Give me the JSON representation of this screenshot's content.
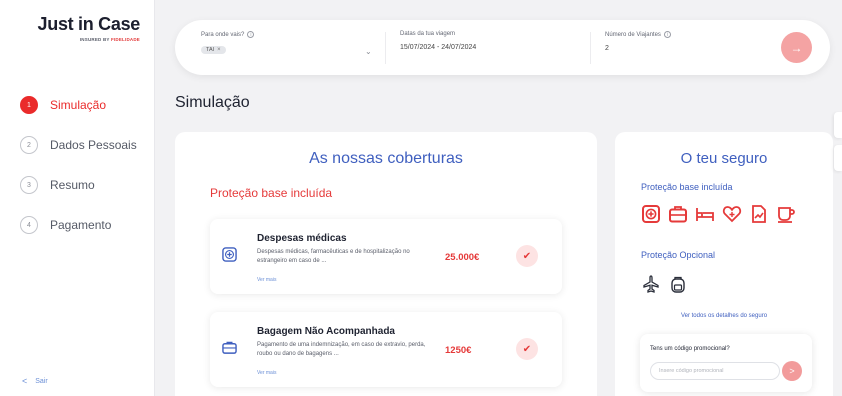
{
  "brand": {
    "name": "Just in Case",
    "sub_prefix": "INSURED BY",
    "sub_brand": "FIDELIDADE"
  },
  "steps": [
    {
      "num": "1",
      "label": "Simulação",
      "active": true
    },
    {
      "num": "2",
      "label": "Dados Pessoais",
      "active": false
    },
    {
      "num": "3",
      "label": "Resumo",
      "active": false
    },
    {
      "num": "4",
      "label": "Pagamento",
      "active": false
    }
  ],
  "logout": {
    "label": "Sair"
  },
  "search": {
    "destination_label": "Para onde vais?",
    "destination_tag": "TAI",
    "dates_label": "Datas da tua viagem",
    "dates_value": "15/07/2024 - 24/07/2024",
    "travelers_label": "Número de Viajantes",
    "travelers_value": "2",
    "go_icon": "arrow-right-icon"
  },
  "page_title": "Simulação",
  "coverages": {
    "title": "As nossas coberturas",
    "subtitle": "Proteção base incluída",
    "items": [
      {
        "name": "Despesas médicas",
        "desc": "Despesas médicas, farmacêuticas e de hospitalização no estrangeiro em caso de ...",
        "more": "Ver mais",
        "amount": "25.000€",
        "icon": "medical-plus-icon"
      },
      {
        "name": "Bagagem Não Acompanhada",
        "desc": "Pagamento de uma indemnização, em caso de extravio, perda, roubo ou dano de bagagens ...",
        "more": "Ver mais",
        "amount": "1250€",
        "icon": "briefcase-icon"
      }
    ]
  },
  "insurance": {
    "title": "O teu seguro",
    "base_heading": "Proteção base incluída",
    "optional_heading": "Proteção Opcional",
    "details_link": "Ver todos os detalhes do seguro",
    "promo_label": "Tens um código promocional?",
    "promo_placeholder": "Insere código promocional"
  },
  "colors": {
    "accent_red": "#ea2b2b",
    "accent_blue": "#3f5fbf",
    "soft_red": "#f4a3a3"
  }
}
